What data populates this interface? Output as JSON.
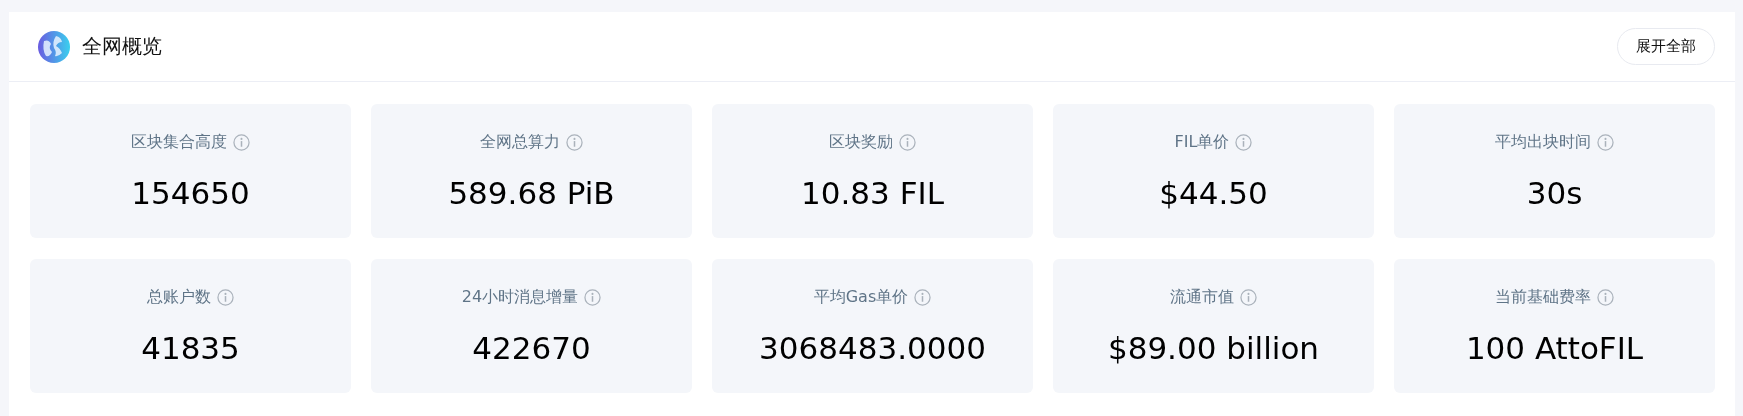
{
  "panel": {
    "title": "全网概览",
    "expand_button": "展开全部"
  },
  "stats": [
    {
      "label": "区块集合高度",
      "value": "154650"
    },
    {
      "label": "全网总算力",
      "value": "589.68 PiB"
    },
    {
      "label": "区块奖励",
      "value": "10.83 FIL"
    },
    {
      "label": "FIL单价",
      "value": "$44.50"
    },
    {
      "label": "平均出块时间",
      "value": "30s"
    },
    {
      "label": "总账户数",
      "value": "41835"
    },
    {
      "label": "24小时消息增量",
      "value": "422670"
    },
    {
      "label": "平均Gas单价",
      "value": "3068483.0000"
    },
    {
      "label": "流通市值",
      "value": "$89.00 billion"
    },
    {
      "label": "当前基础费率",
      "value": "100 AttoFIL"
    }
  ]
}
